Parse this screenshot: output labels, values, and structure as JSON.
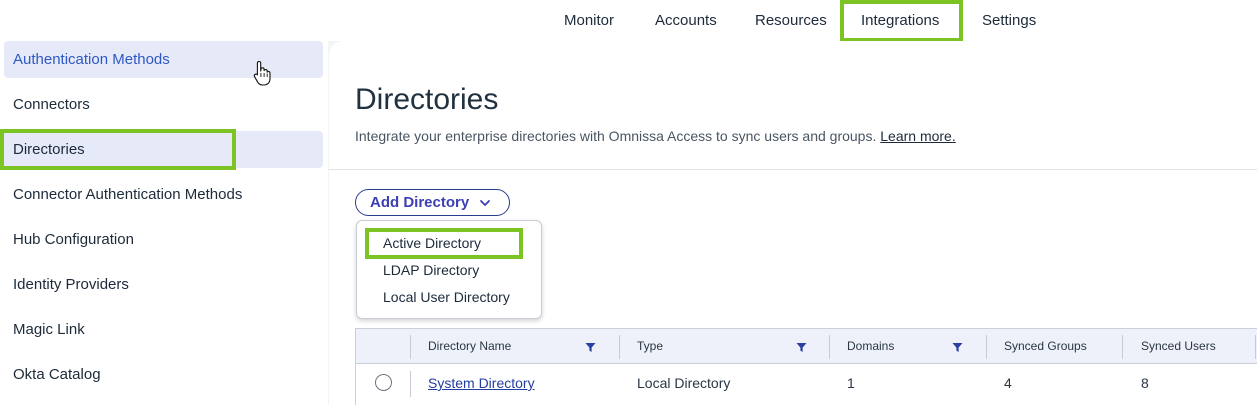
{
  "topnav": {
    "items": [
      {
        "label": "Monitor"
      },
      {
        "label": "Accounts"
      },
      {
        "label": "Resources"
      },
      {
        "label": "Integrations"
      },
      {
        "label": "Settings"
      }
    ],
    "active": "Integrations"
  },
  "sidebar": {
    "items": [
      {
        "label": "Authentication Methods"
      },
      {
        "label": "Connectors"
      },
      {
        "label": "Directories"
      },
      {
        "label": "Connector Authentication Methods"
      },
      {
        "label": "Hub Configuration"
      },
      {
        "label": "Identity Providers"
      },
      {
        "label": "Magic Link"
      },
      {
        "label": "Okta Catalog"
      }
    ],
    "active": "Directories",
    "hovered": "Authentication Methods"
  },
  "main": {
    "title": "Directories",
    "description": "Integrate your enterprise directories with Omnissa Access to sync users and groups.",
    "learn_more": "Learn more.",
    "add_button": "Add Directory",
    "dropdown": {
      "items": [
        {
          "label": "Active Directory"
        },
        {
          "label": "LDAP Directory"
        },
        {
          "label": "Local User Directory"
        }
      ]
    },
    "table": {
      "columns": [
        {
          "label": "Directory Name"
        },
        {
          "label": "Type"
        },
        {
          "label": "Domains"
        },
        {
          "label": "Synced Groups"
        },
        {
          "label": "Synced Users"
        }
      ],
      "rows": [
        {
          "name": "System Directory",
          "type": "Local Directory",
          "domains": "1",
          "synced_groups": "4",
          "synced_users": "8"
        }
      ]
    }
  },
  "colors": {
    "highlight": "#7cc324",
    "accent": "#3c3fb3",
    "link": "#243ea0",
    "active_bg": "#e6eaf8"
  },
  "icons": {
    "dropdown": "chevron-down-icon",
    "filter": "filter-icon",
    "cursor": "hand-pointer-icon"
  }
}
